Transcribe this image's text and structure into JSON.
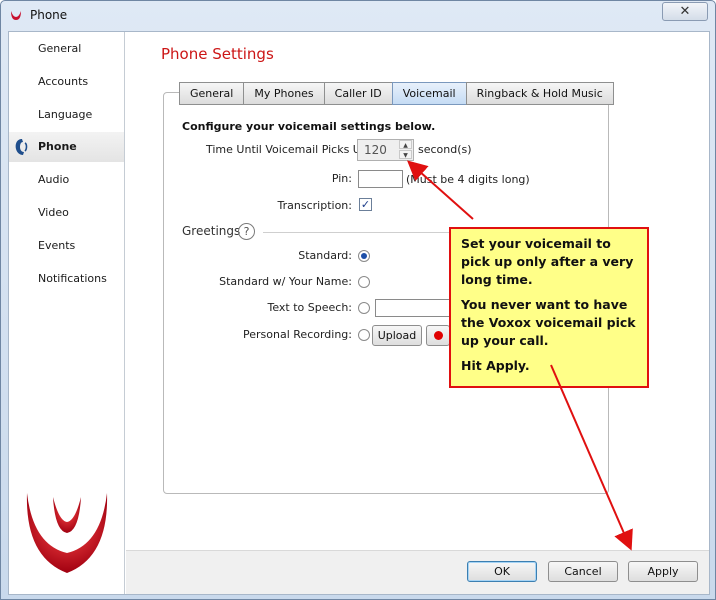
{
  "window": {
    "title": "Phone",
    "close_symbol": "✕"
  },
  "sidebar": {
    "items": [
      {
        "label": "General"
      },
      {
        "label": "Accounts"
      },
      {
        "label": "Language"
      },
      {
        "label": "Phone",
        "active": true
      },
      {
        "label": "Audio"
      },
      {
        "label": "Video"
      },
      {
        "label": "Events"
      },
      {
        "label": "Notifications"
      }
    ]
  },
  "main": {
    "title": "Phone Settings",
    "tabs": [
      {
        "label": "General"
      },
      {
        "label": "My Phones"
      },
      {
        "label": "Caller ID"
      },
      {
        "label": "Voicemail",
        "active": true
      },
      {
        "label": "Ringback & Hold Music"
      }
    ],
    "voicemail": {
      "heading": "Configure your voicemail settings below.",
      "pickup_label": "Time Until Voicemail Picks Up:",
      "pickup_value": "120",
      "pickup_unit": "second(s)",
      "pin_label": "Pin:",
      "pin_value": "",
      "pin_hint": "(Must be 4 digits long)",
      "transcription_label": "Transcription:",
      "transcription_checked": true,
      "greetings_title": "Greetings",
      "help_symbol": "?",
      "greetings": {
        "standard": "Standard:",
        "standard_name": "Standard w/ Your Name:",
        "tts": "Text to Speech:",
        "personal": "Personal Recording:",
        "upload": "Upload"
      }
    }
  },
  "buttons": {
    "ok": "OK",
    "cancel": "Cancel",
    "apply": "Apply"
  },
  "callout": {
    "line1": "Set your voicemail to pick up only after a very long time.",
    "line2": "You never want to have the Voxox voicemail pick up your call.",
    "line3": "Hit Apply."
  },
  "colors": {
    "accent_red": "#cc1616",
    "callout_bg": "#ffff88",
    "arrow_red": "#e01010"
  }
}
